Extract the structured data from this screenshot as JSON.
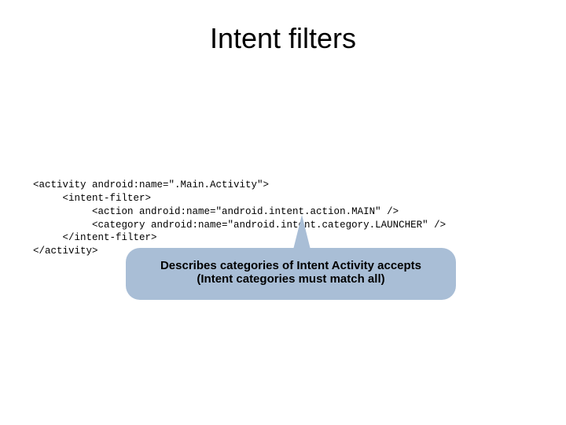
{
  "title": "Intent filters",
  "code": {
    "l1": "<activity android:name=\".Main.Activity\">",
    "l2": "     <intent-filter>",
    "l3": "          <action android:name=\"android.intent.action.MAIN\" />",
    "l4": "          <category android:name=\"android.intent.category.LAUNCHER\" />",
    "l5": "     </intent-filter>",
    "l6": "</activity>"
  },
  "callout": {
    "line1": "Describes categories of Intent Activity accepts",
    "line2": "(Intent categories must match all)"
  }
}
